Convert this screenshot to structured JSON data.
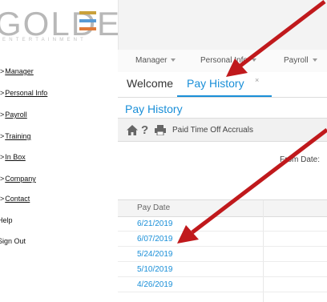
{
  "logo": {
    "text": "GOLDEN",
    "subtext": "ENTERTAINMENT",
    "bar_colors": [
      "#c9a13b",
      "#5a9bd4",
      "#e07b39"
    ]
  },
  "left_nav": [
    {
      "caret": ">",
      "label": "Manager",
      "link": true
    },
    {
      "caret": ">",
      "label": "Personal Info",
      "link": true
    },
    {
      "caret": ">",
      "label": "Payroll",
      "link": true
    },
    {
      "caret": ">",
      "label": "Training",
      "link": true
    },
    {
      "caret": ">",
      "label": "In Box",
      "link": true
    },
    {
      "caret": ">",
      "label": "Company",
      "link": true
    },
    {
      "caret": ">",
      "label": "Contact",
      "link": true
    },
    {
      "caret": "",
      "label": "Help",
      "link": false
    },
    {
      "caret": "",
      "label": "Sign Out",
      "link": false
    }
  ],
  "top_menu": [
    "Manager",
    "Personal Info",
    "Payroll"
  ],
  "tabs": {
    "welcome": "Welcome",
    "active": "Pay History",
    "close": "×"
  },
  "page_title": "Pay History",
  "toolbar": {
    "paid_time_off": "Paid Time Off Accruals"
  },
  "filter": {
    "from_date_label": "From Date:"
  },
  "table": {
    "header": "Pay Date",
    "rows": [
      "6/21/2019",
      "6/07/2019",
      "5/24/2019",
      "5/10/2019",
      "4/26/2019"
    ]
  },
  "colors": {
    "accent": "#1a8fd8",
    "annotation_arrow": "#c0191c"
  }
}
